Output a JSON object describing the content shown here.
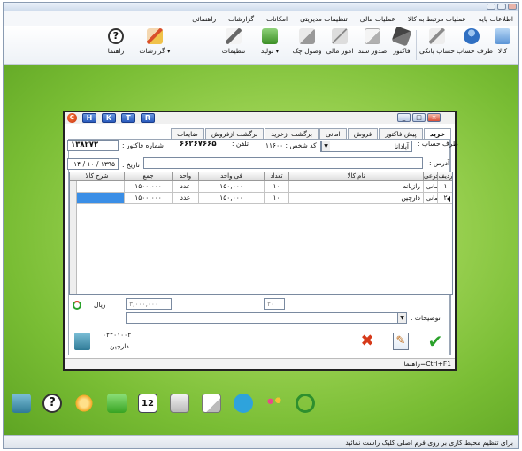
{
  "menu": [
    "اطلاعات پایه",
    "عملیات مرتبط به کالا",
    "عملیات مالی",
    "تنظیمات مدیریتی",
    "امکانات",
    "گزارشات",
    "راهنمائی"
  ],
  "ribbon": {
    "kala": "کالا",
    "taraf_hesab": "طرف حساب",
    "hesab_banki": "حساب بانکی",
    "factor": "فاکتور",
    "sodur_sanad": "صدور سند",
    "omur_mali": "امور مالی",
    "vosul_chek": "وصول چک",
    "tolid": "تولید",
    "tanzimat": "تنظیمات",
    "gozareshat": "گزارشات",
    "rahnama": "راهنما"
  },
  "window": {
    "logo": "C",
    "hotkeys": [
      "H",
      "K",
      "T",
      "R"
    ],
    "tabs": [
      "خرید",
      "پیش فاکتور",
      "فروش",
      "امانی",
      "برگشت ازخرید",
      "برگشت ازفروش",
      "ضایعات"
    ],
    "active_tab": "خرید"
  },
  "form": {
    "party_label": "طرف حساب :",
    "party_value": "آپادانا",
    "person_code": "کد شخص : ۱۱۶۰۰",
    "phone_label": "تلفن :",
    "phone_value": "۶۶۲۶۷۶۶۵",
    "invoice_no_label": "شماره فاکتور :",
    "invoice_no_value": "۱۳۸۲۷۲",
    "address_label": "آدرس :",
    "address_value": "",
    "date_label": "تاریخ :",
    "date_value": "۱۳۹۵ / ۱۰ / ۱۴",
    "total_label": "ریال",
    "total_value": "۳,۰۰۰,۰۰۰",
    "qty_total": "۲۰",
    "desc_label": "توضیحات :",
    "desc_value": "",
    "customer_phone": "۰۲۲۰۱۰۰۲",
    "customer_name": "دارچین"
  },
  "grid": {
    "headers": {
      "radif": "ردیف",
      "goruh": "گروه فرعی",
      "nam_kala": "نام کالا",
      "tedad": "تعداد",
      "fi": "فی واحد",
      "vahed": "واحد",
      "jam": "جمع",
      "sharh": "شرح کالا"
    },
    "rows": [
      {
        "radif": "۱",
        "goruh": "درمانی",
        "nam_kala": "رازیانه",
        "tedad": "۱۰",
        "fi": "۱۵۰,۰۰۰",
        "vahed": "عدد",
        "jam": "۱۵۰۰,۰۰۰",
        "sharh": ""
      },
      {
        "radif": "۲",
        "goruh": "درمانی",
        "nam_kala": "دارچین",
        "tedad": "۱۰",
        "fi": "۱۵۰,۰۰۰",
        "vahed": "عدد",
        "jam": "۱۵۰۰,۰۰۰",
        "sharh": ""
      }
    ]
  },
  "footer": {
    "shortcut": "راهنما=Ctrl+F1"
  },
  "status": {
    "text": "برای تنظیم محیط کاری بر روی فرم اصلی کلیک راست نمائید"
  },
  "taskbar": {
    "calendar_day": "12"
  },
  "colors": {
    "desktop": "#8dc63f",
    "accent": "#2a5bbd",
    "grid_selected": "#3a8ee6",
    "ok_green": "#2aa12a",
    "cancel_red": "#d63a1a"
  }
}
